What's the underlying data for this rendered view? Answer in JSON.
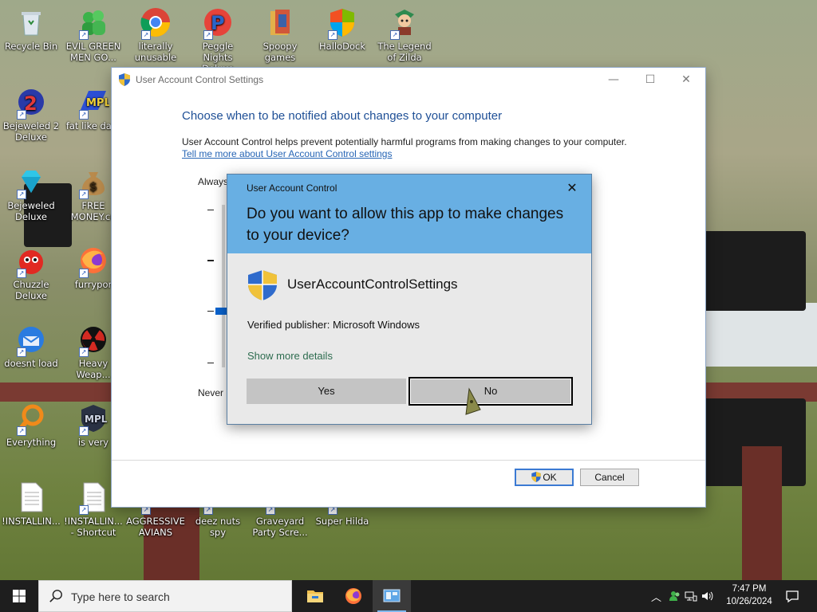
{
  "desktop": {
    "icons": [
      {
        "label": "Recycle Bin"
      },
      {
        "label": "EVIL GREEN MEN GO..."
      },
      {
        "label": "literally unusable"
      },
      {
        "label": "Peggle Nights Deluxe"
      },
      {
        "label": "Spoopy games"
      },
      {
        "label": "HalloDock"
      },
      {
        "label": "The Legend of Zilda"
      },
      {
        "label": "Bejeweled 2 Deluxe"
      },
      {
        "label": "fat like dark"
      },
      {
        "label": "Bejeweled Deluxe"
      },
      {
        "label": "FREE MONEY.co"
      },
      {
        "label": "Chuzzle Deluxe"
      },
      {
        "label": "furrypor"
      },
      {
        "label": "doesnt load"
      },
      {
        "label": "Heavy Weap..."
      },
      {
        "label": "Everything"
      },
      {
        "label": "is very"
      },
      {
        "label": "!INSTALLIN..."
      },
      {
        "label": "!INSTALLIN... - Shortcut"
      },
      {
        "label": "AGGRESSIVE AVIANS"
      },
      {
        "label": "deez nuts spy"
      },
      {
        "label": "Graveyard Party Scre..."
      },
      {
        "label": "Super Hilda"
      }
    ]
  },
  "uac_settings": {
    "title": "User Account Control Settings",
    "heading": "Choose when to be notified about changes to your computer",
    "description": "User Account Control helps prevent potentially harmful programs from making changes to your computer.",
    "link": "Tell me more about User Account Control settings",
    "slider_top_label": "Always",
    "slider_bottom_label": "Never",
    "slider_level": "3 of 4",
    "ok_label": "OK",
    "cancel_label": "Cancel"
  },
  "uac_prompt": {
    "caption": "User Account Control",
    "question": "Do you want to allow this app to make changes to your device?",
    "app_name": "UserAccountControlSettings",
    "publisher": "Verified publisher: Microsoft Windows",
    "more_details": "Show more details",
    "yes_label": "Yes",
    "no_label": "No",
    "header_color": "#68afe3"
  },
  "taskbar": {
    "search_placeholder": "Type here to search",
    "time": "7:47 PM",
    "date": "10/26/2024",
    "pinned": [
      "file-explorer-icon",
      "firefox-icon",
      "uac-settings-icon"
    ]
  }
}
